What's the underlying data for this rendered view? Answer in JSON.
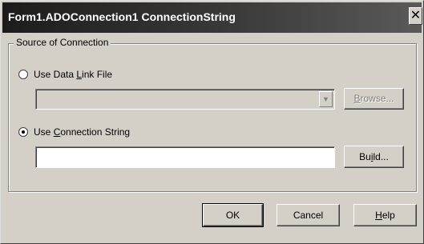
{
  "window": {
    "title": "Form1.ADOConnection1 ConnectionString",
    "close_glyph": "✕"
  },
  "source_group": {
    "label": "Source of Connection",
    "data_link_option": {
      "label_pre": "Use Data ",
      "label_mnemonic": "L",
      "label_post": "ink File",
      "checked": false
    },
    "data_link_value": "",
    "browse_button": {
      "label_mnemonic": "B",
      "label_post": "rowse...",
      "enabled": false
    },
    "connection_string_option": {
      "label_pre": "Use ",
      "label_mnemonic": "C",
      "label_post": "onnection String",
      "checked": true
    },
    "connection_string_value": "",
    "build_button": {
      "label_pre": "Bu",
      "label_mnemonic": "i",
      "label_post": "ld..."
    }
  },
  "buttons": {
    "ok": "OK",
    "cancel": "Cancel",
    "help_mnemonic": "H",
    "help_post": "elp"
  },
  "icons": {
    "dropdown_arrow": "chevron-down-icon",
    "close": "close-icon"
  }
}
